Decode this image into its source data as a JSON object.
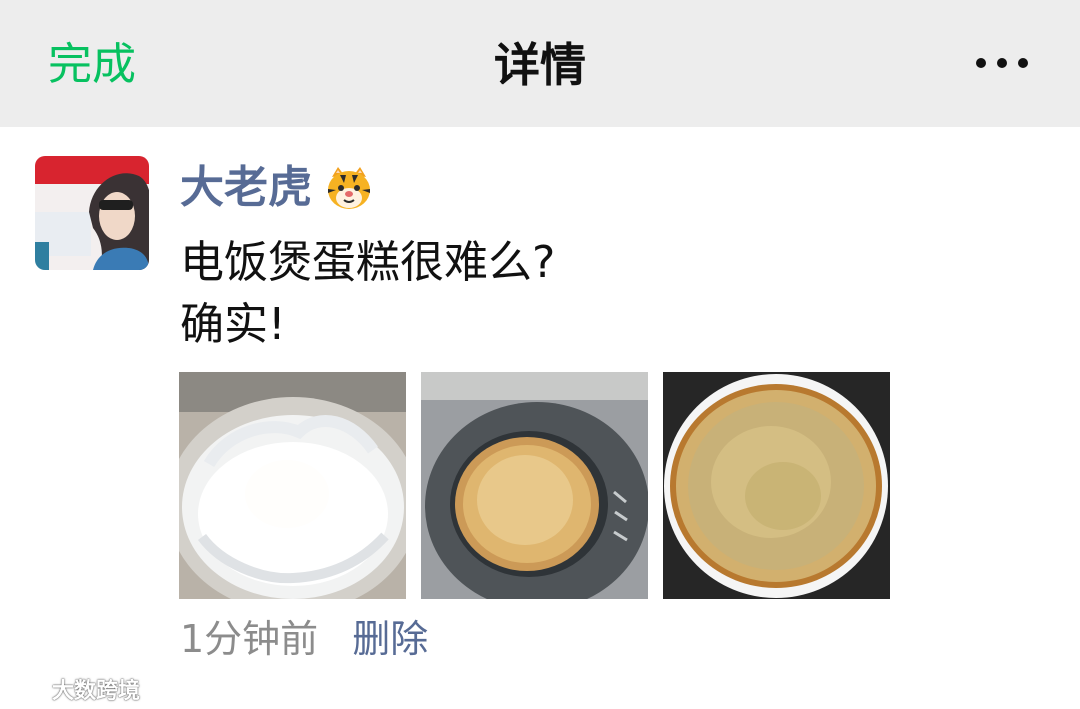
{
  "nav": {
    "left_label": "完成",
    "title": "详情",
    "more_icon": "more-icon"
  },
  "post": {
    "author": "大老虎",
    "author_emoji_icon": "tiger-face-icon",
    "text_lines": [
      "电饭煲蛋糕很难么?",
      "确实!"
    ],
    "photos": [
      {
        "name": "whipped-egg-whites-photo"
      },
      {
        "name": "cake-in-rice-cooker-photo"
      },
      {
        "name": "finished-cake-photo"
      }
    ],
    "time": "1分钟前",
    "delete_label": "删除"
  },
  "watermark": {
    "text": "大数跨境",
    "icon": "watermark-logo-icon"
  },
  "colors": {
    "nav_bg": "#ededed",
    "accent_green": "#07c160",
    "link_blue": "#576b95",
    "text_dark": "#111111",
    "muted": "#8c8c8c"
  }
}
